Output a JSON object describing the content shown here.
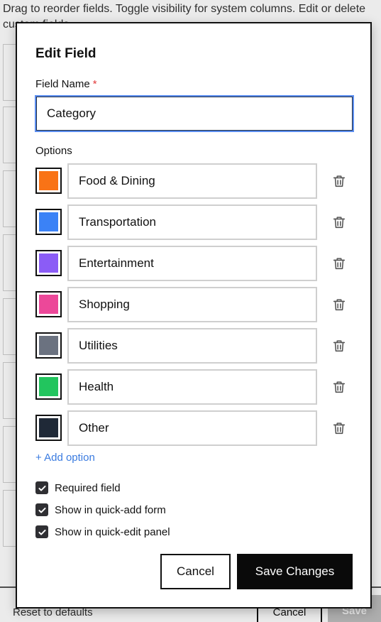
{
  "background": {
    "instructions": "Drag to reorder fields. Toggle visibility for system columns. Edit or delete custom fields.",
    "footer": {
      "reset_label": "Reset to defaults",
      "cancel_label": "Cancel",
      "save_label": "Save"
    }
  },
  "modal": {
    "title": "Edit Field",
    "field_name_label": "Field Name",
    "required_marker": "*",
    "field_name_value": "Category",
    "options_label": "Options",
    "options": [
      {
        "label": "Food & Dining",
        "color": "#f97316"
      },
      {
        "label": "Transportation",
        "color": "#3b82f6"
      },
      {
        "label": "Entertainment",
        "color": "#8b5cf6"
      },
      {
        "label": "Shopping",
        "color": "#ec4899"
      },
      {
        "label": "Utilities",
        "color": "#6b7280"
      },
      {
        "label": "Health",
        "color": "#22c55e"
      },
      {
        "label": "Other",
        "color": "#1f2937"
      }
    ],
    "add_option_label": "+ Add option",
    "checkboxes": [
      {
        "label": "Required field",
        "checked": true
      },
      {
        "label": "Show in quick-add form",
        "checked": true
      },
      {
        "label": "Show in quick-edit panel",
        "checked": true
      }
    ],
    "cancel_label": "Cancel",
    "save_label": "Save Changes"
  }
}
